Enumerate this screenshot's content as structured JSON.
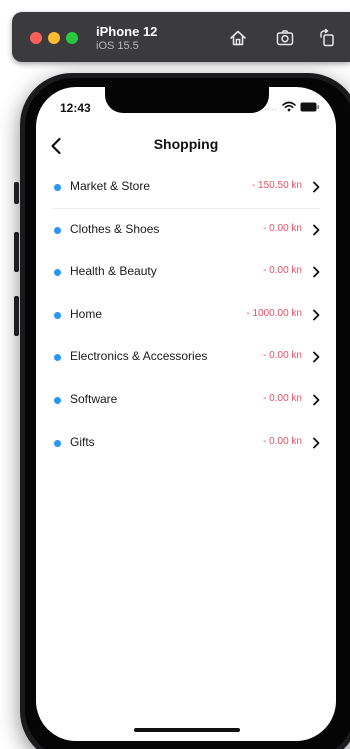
{
  "simulator": {
    "device_name": "iPhone 12",
    "os_version": "iOS 15.5",
    "icons": [
      "home-icon",
      "screenshot-icon",
      "rotate-icon"
    ]
  },
  "status_bar": {
    "time": "12:43",
    "carrier_dots": "....",
    "icons": [
      "wifi-icon",
      "battery-icon"
    ]
  },
  "nav": {
    "title": "Shopping",
    "back_icon": "chevron-left-icon"
  },
  "categories": [
    {
      "label": "Market & Store",
      "amount": "- 150.50 kn"
    },
    {
      "label": "Clothes & Shoes",
      "amount": "- 0.00 kn"
    },
    {
      "label": "Health & Beauty",
      "amount": "- 0.00 kn"
    },
    {
      "label": "Home",
      "amount": "- 1000.00 kn"
    },
    {
      "label": "Electronics & Accessories",
      "amount": "- 0.00 kn"
    },
    {
      "label": "Software",
      "amount": "- 0.00 kn"
    },
    {
      "label": "Gifts",
      "amount": "- 0.00 kn"
    }
  ],
  "colors": {
    "accent_dot": "#2896f2",
    "amount_negative": "#e85063",
    "toolbar_bg": "#3b3b3d"
  }
}
